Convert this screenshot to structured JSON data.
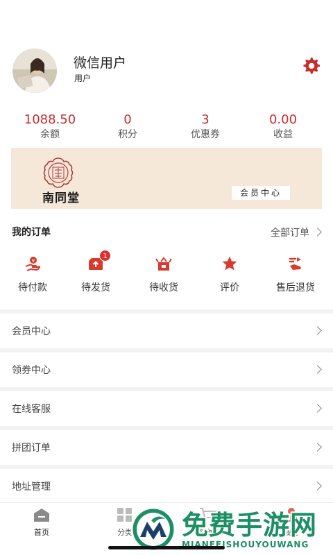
{
  "profile": {
    "name": "微信用户",
    "type": "用户"
  },
  "stats": [
    {
      "value": "1088.50",
      "label": "余额"
    },
    {
      "value": "0",
      "label": "积分"
    },
    {
      "value": "3",
      "label": "优惠券"
    },
    {
      "value": "0.00",
      "label": "收益"
    }
  ],
  "banner": {
    "seal_text": "南同堂",
    "brand": "南同堂",
    "tag": "会员中心"
  },
  "orders": {
    "title": "我的订单",
    "all": "全部订单",
    "items": [
      {
        "label": "待付款",
        "icon": "wallet-hand-icon"
      },
      {
        "label": "待发货",
        "icon": "box-upload-icon",
        "badge": "1"
      },
      {
        "label": "待收货",
        "icon": "package-icon"
      },
      {
        "label": "评价",
        "icon": "star-icon"
      },
      {
        "label": "售后退货",
        "icon": "return-icon"
      }
    ]
  },
  "menu": [
    "会员中心",
    "领券中心",
    "在线客服",
    "拼团订单",
    "地址管理"
  ],
  "tabbar": [
    {
      "label": "首页",
      "icon": "home-icon"
    },
    {
      "label": "分类",
      "icon": "category-icon"
    },
    {
      "label": "购物车",
      "icon": "cart-icon"
    },
    {
      "label": "我的",
      "icon": "user-icon"
    }
  ],
  "watermark": {
    "big": "免费手游网",
    "small": "MIANFEISHOUYOUWANG"
  },
  "colors": {
    "accent": "#c92b2b",
    "banner_bg": "#f5e8d8",
    "watermark": "#1c8f64"
  }
}
